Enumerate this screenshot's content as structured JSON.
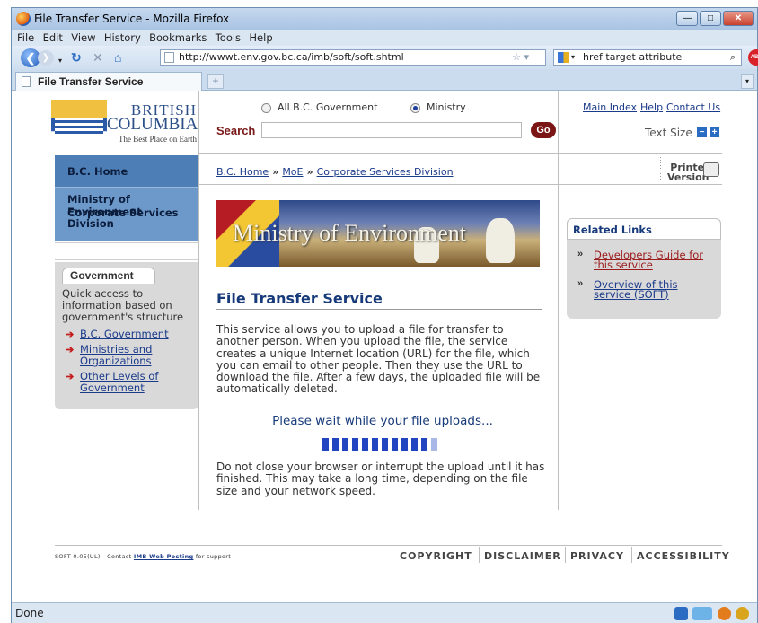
{
  "window": {
    "title": "File Transfer Service - Mozilla Firefox"
  },
  "menu": [
    "File",
    "Edit",
    "View",
    "History",
    "Bookmarks",
    "Tools",
    "Help"
  ],
  "navbar": {
    "url": "http://wwwt.env.gov.bc.ca/imb/soft/soft.shtml",
    "search_value": "href target attribute"
  },
  "tab": {
    "label": "File Transfer Service",
    "new_tab": "+"
  },
  "status": {
    "text": "Done"
  },
  "logo": {
    "line1": "BRITISH",
    "line2": "COLUMBIA",
    "tagline": "The Best Place on Earth"
  },
  "search": {
    "scope_all": "All B.C. Government",
    "scope_ministry": "Ministry",
    "selected_scope": "Ministry",
    "label": "Search",
    "value": "",
    "go": "Go"
  },
  "top_links": {
    "main_index": "Main Index",
    "help": "Help",
    "contact": "Contact Us",
    "text_size": "Text Size"
  },
  "left_nav": {
    "home": "B.C. Home",
    "ministry": "Ministry of Environment",
    "division_line1": "Corporate Services",
    "division_line2": "Division"
  },
  "government": {
    "header": "Government",
    "desc1": "Quick access to",
    "desc2": "information based on",
    "desc3": "government's structure",
    "link1": "B.C. Government",
    "link2a": "Ministries and",
    "link2b": "Organizations",
    "link3a": "Other Levels of",
    "link3b": "Government"
  },
  "breadcrumb": {
    "home": "B.C. Home",
    "moe": "MoE",
    "division": "Corporate Services Division",
    "sep": "»"
  },
  "printer": {
    "line1": "Printer",
    "line2": "Version"
  },
  "banner": {
    "title": "Ministry of Environment"
  },
  "main": {
    "title": "File Transfer Service",
    "p1_l1": "This service allows you to upload a file for transfer to",
    "p1_l2": "another person. When you upload the file, the service",
    "p1_l3": "creates a unique Internet location (URL) for the file, which",
    "p1_l4": "you can email to other people. Then they use the URL to",
    "p1_l5": "download the file. After a few days, the uploaded file will be",
    "p1_l6": "automatically deleted.",
    "wait": "Please wait while your file uploads...",
    "p2_l1": "Do not close your browser or interrupt the upload until it has",
    "p2_l2": "finished. This may take a long time, depending on the file",
    "p2_l3": "size and your network speed."
  },
  "progress": {
    "filled_blocks": 11,
    "total_blocks": 12
  },
  "related": {
    "header": "Related Links",
    "l1a": "Developers Guide for",
    "l1b": "this service",
    "l2a": "Overview of this",
    "l2b": "service (SOFT)",
    "arrow": "»"
  },
  "footer": {
    "soft_pre": "SOFT 0.05(UL) - Contact",
    "soft_link": "IMB Web Posting",
    "soft_post": "for support",
    "copyright": "COPYRIGHT",
    "disclaimer": "DISCLAIMER",
    "privacy": "PRIVACY",
    "accessibility": "ACCESSIBILITY"
  },
  "colors": {
    "header_blue": "#4d7fb6",
    "nav_blue": "#6c99c9",
    "go_red": "#7b1414",
    "progress_blue": "#2144c0",
    "visited_link": "#9b1c1c"
  }
}
